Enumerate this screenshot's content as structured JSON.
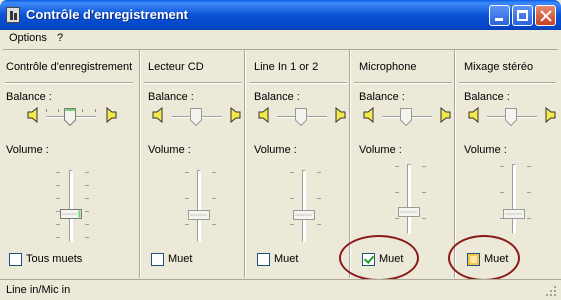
{
  "window": {
    "title": "Contrôle d'enregistrement"
  },
  "menu": {
    "items": [
      "Options",
      "?"
    ]
  },
  "columns": [
    {
      "title": "Contrôle d'enregistrement",
      "balance_label": "Balance :",
      "volume_label": "Volume :",
      "checkbox_label": "Tous muets",
      "checked": false
    },
    {
      "title": "Lecteur CD",
      "balance_label": "Balance :",
      "volume_label": "Volume :",
      "checkbox_label": "Muet",
      "checked": false
    },
    {
      "title": "Line In 1 or 2",
      "balance_label": "Balance :",
      "volume_label": "Volume :",
      "checkbox_label": "Muet",
      "checked": false
    },
    {
      "title": "Microphone",
      "balance_label": "Balance :",
      "volume_label": "Volume :",
      "checkbox_label": "Muet",
      "checked": true
    },
    {
      "title": "Mixage stéréo",
      "balance_label": "Balance :",
      "volume_label": "Volume :",
      "checkbox_label": "Muet",
      "checked": false
    }
  ],
  "status": {
    "text": "Line in/Mic in"
  },
  "icons": [
    "app-icon",
    "speaker-left-icon",
    "speaker-right-icon",
    "minimize-icon",
    "maximize-icon",
    "close-icon",
    "size-grip-icon"
  ],
  "colors": {
    "titlebar": "#0A53D6",
    "annotation_oval": "#8B1A1A",
    "checkmark": "#21A121",
    "master_thumb": "#6BD46B"
  }
}
